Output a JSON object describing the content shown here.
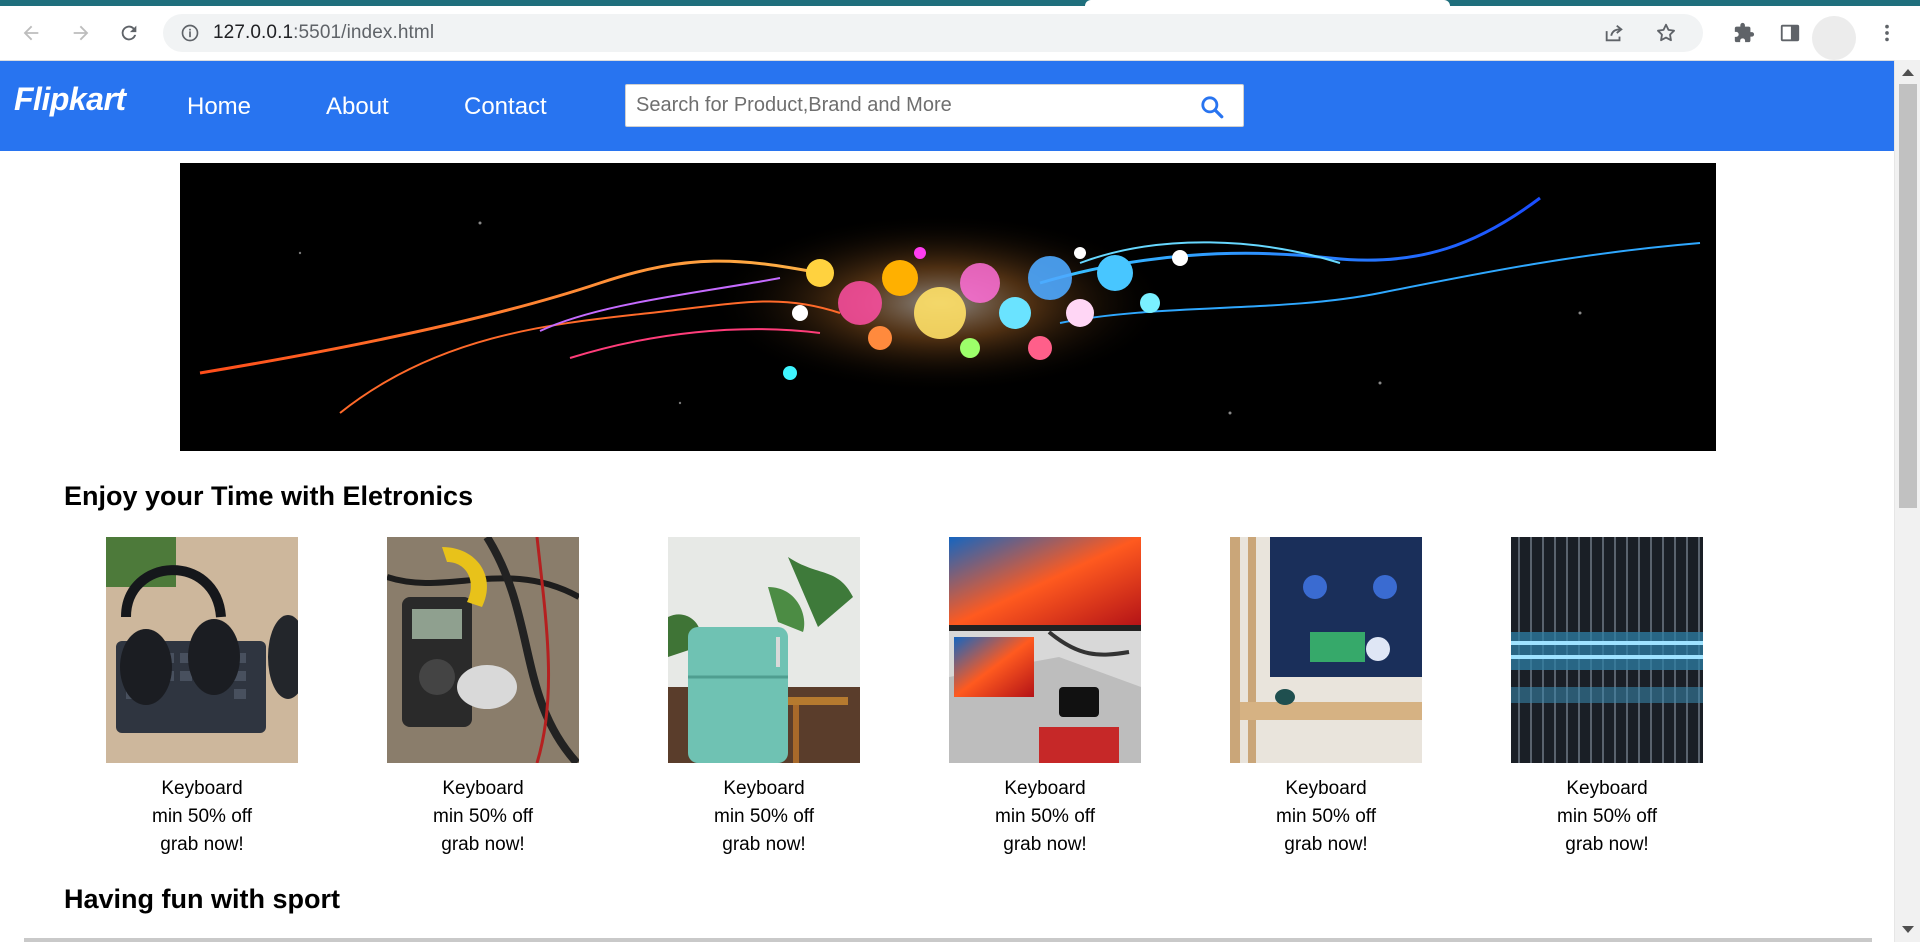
{
  "browser": {
    "url_host": "127.0.0.1",
    "url_rest": ":5501/index.html"
  },
  "nav": {
    "brand": "Flipkart",
    "links": [
      "Home",
      "About",
      "Contact"
    ]
  },
  "search": {
    "placeholder": "Search for Product,Brand and More"
  },
  "sections": [
    {
      "title": "Enjoy your Time with Eletronics",
      "products": [
        {
          "name": "Keyboard",
          "offer": "min 50% off",
          "cta": "grab now!"
        },
        {
          "name": "Keyboard",
          "offer": "min 50% off",
          "cta": "grab now!"
        },
        {
          "name": "Keyboard",
          "offer": "min 50% off",
          "cta": "grab now!"
        },
        {
          "name": "Keyboard",
          "offer": "min 50% off",
          "cta": "grab now!"
        },
        {
          "name": "Keyboard",
          "offer": "min 50% off",
          "cta": "grab now!"
        },
        {
          "name": "Keyboard",
          "offer": "min 50% off",
          "cta": "grab now!"
        }
      ]
    },
    {
      "title": "Having fun with sport"
    }
  ],
  "colors": {
    "navbar": "#2874f0",
    "tabstrip": "#1f6f7d",
    "search_icon": "#2874f0"
  },
  "icons": {
    "back": "arrow-left-icon",
    "forward": "arrow-right-icon",
    "reload": "reload-icon",
    "site_info": "info-icon",
    "share": "share-icon",
    "bookmark": "star-icon",
    "extensions": "puzzle-icon",
    "side_panel": "side-panel-icon",
    "menu": "kebab-menu-icon",
    "search": "search-icon"
  }
}
